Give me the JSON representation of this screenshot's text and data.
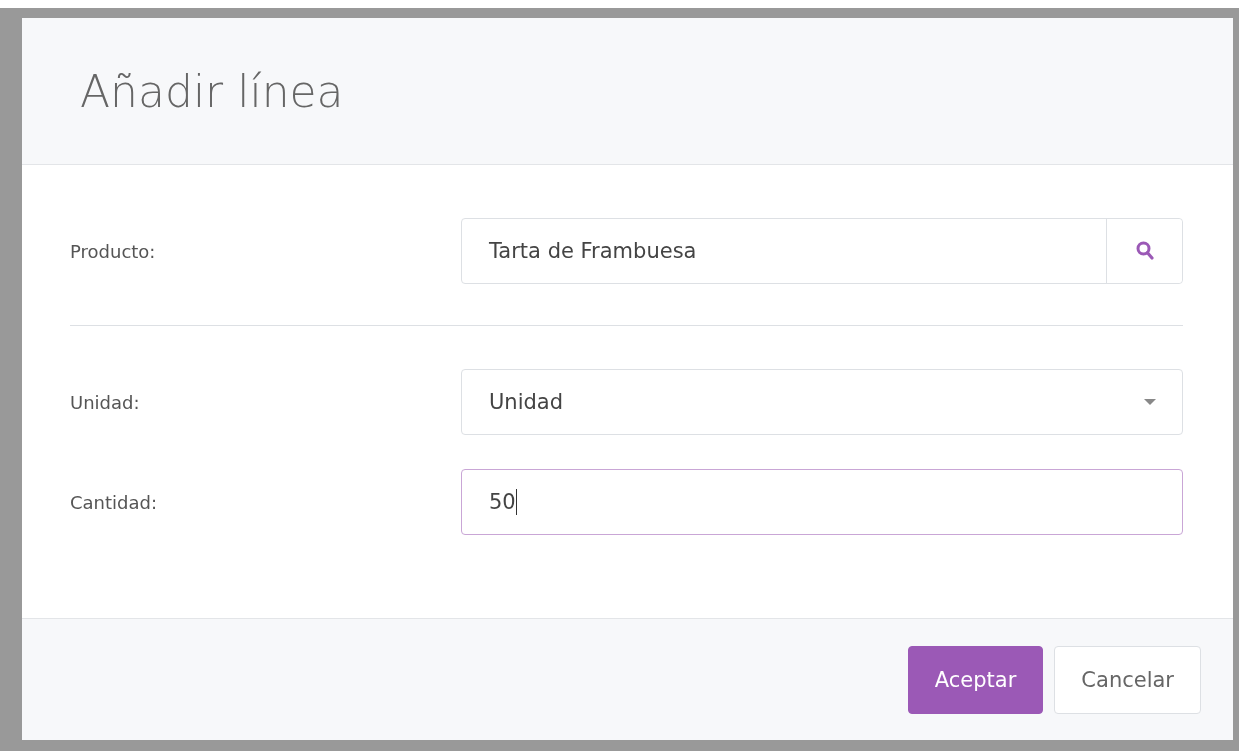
{
  "dialog": {
    "title": "Añadir línea",
    "fields": [
      {
        "kind": "search",
        "label": "Producto:",
        "value": "Tarta de Frambuesa"
      },
      {
        "kind": "select",
        "label": "Unidad:",
        "value": "Unidad"
      },
      {
        "kind": "text",
        "label": "Cantidad:",
        "value": "50",
        "focused": true
      }
    ],
    "buttons": [
      {
        "label": "Aceptar",
        "primary": true
      },
      {
        "label": "Cancelar",
        "primary": false
      }
    ]
  }
}
